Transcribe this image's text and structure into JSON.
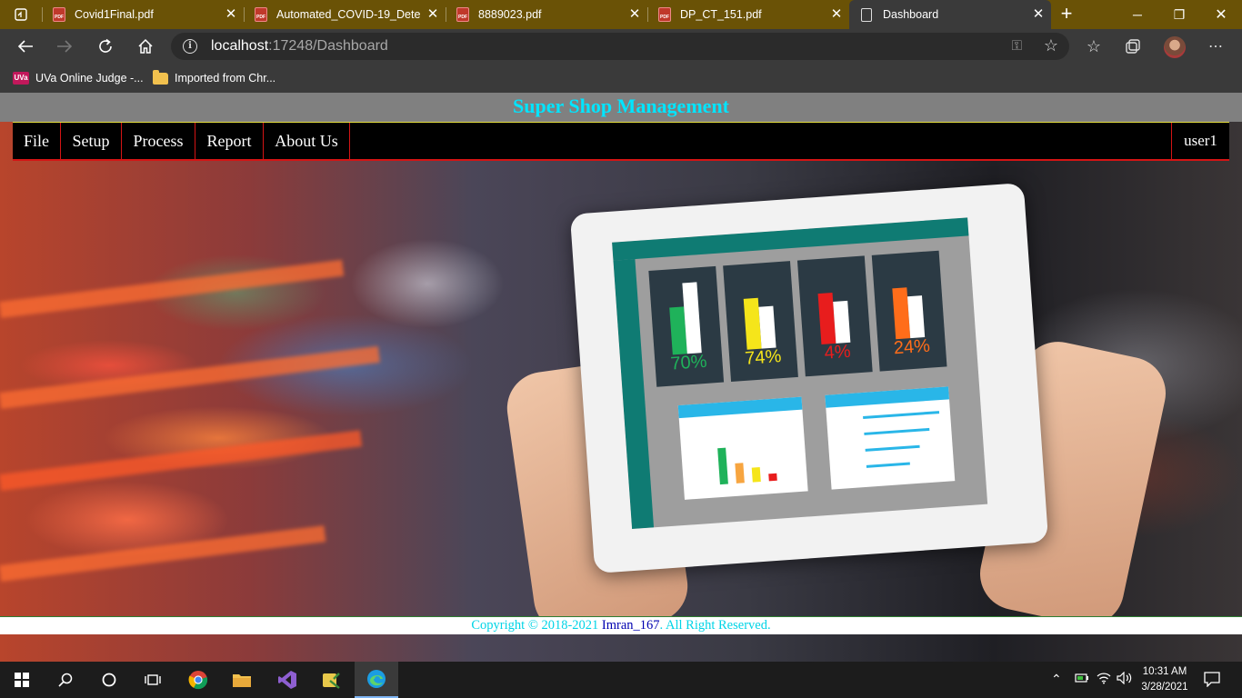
{
  "browser": {
    "tabs": [
      {
        "label": "Covid1Final.pdf",
        "icon": "pdf-icon"
      },
      {
        "label": "Automated_COVID-19_Detect",
        "icon": "pdf-icon"
      },
      {
        "label": "8889023.pdf",
        "icon": "pdf-icon"
      },
      {
        "label": "DP_CT_151.pdf",
        "icon": "pdf-icon"
      },
      {
        "label": "Dashboard",
        "icon": "document-icon",
        "active": true
      }
    ],
    "address": {
      "host": "localhost",
      "rest": ":17248/Dashboard"
    },
    "bookmarks": [
      {
        "label": "UVa Online Judge -...",
        "icon": "uva-icon",
        "icon_text": "UVa"
      },
      {
        "label": "Imported from Chr...",
        "icon": "folder-icon"
      }
    ],
    "pdf_icon_text": "PDF"
  },
  "app": {
    "title": "Super Shop Management",
    "menu": [
      "File",
      "Setup",
      "Process",
      "Report",
      "About Us"
    ],
    "user": "user1",
    "footer": {
      "prefix": "Copyright © 2018-2021 ",
      "author": "Imran_167",
      "suffix": ". All Right Reserved."
    },
    "colors": {
      "title": "#00e5ff",
      "menu_border": "#d41414",
      "footer_text": "#00d4e6",
      "footer_author": "#0000b0"
    }
  },
  "illustration": {
    "kpis": [
      {
        "value": "70%",
        "color": "#1fb25a"
      },
      {
        "value": "74%",
        "color": "#f5e51a"
      },
      {
        "value": "4%",
        "color": "#e81d1d"
      },
      {
        "value": "24%",
        "color": "#ff6d1a"
      }
    ]
  },
  "taskbar": {
    "time": "10:31 AM",
    "date": "3/28/2021"
  }
}
